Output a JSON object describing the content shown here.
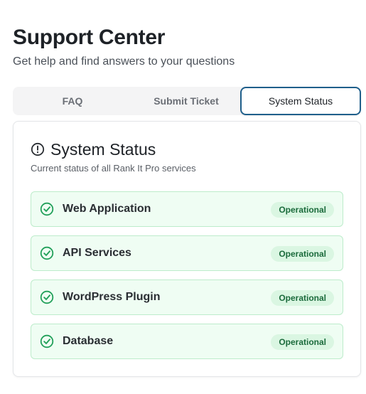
{
  "header": {
    "title": "Support Center",
    "subtitle": "Get help and find answers to your questions"
  },
  "tabs": [
    {
      "label": "FAQ",
      "active": false
    },
    {
      "label": "Submit Ticket",
      "active": false
    },
    {
      "label": "System Status",
      "active": true
    }
  ],
  "status_card": {
    "icon": "alert-circle-icon",
    "title": "System Status",
    "description": "Current status of all Rank It Pro services",
    "services": [
      {
        "name": "Web Application",
        "status": "Operational",
        "icon": "check-circle-icon"
      },
      {
        "name": "API Services",
        "status": "Operational",
        "icon": "check-circle-icon"
      },
      {
        "name": "WordPress Plugin",
        "status": "Operational",
        "icon": "check-circle-icon"
      },
      {
        "name": "Database",
        "status": "Operational",
        "icon": "check-circle-icon"
      }
    ]
  },
  "colors": {
    "accent_border": "#1f5f8b",
    "operational_bg": "#effdf3",
    "operational_border": "#bdeccb",
    "operational_icon": "#22a05a",
    "badge_bg": "#daf6e2",
    "badge_text": "#1b6b3c"
  }
}
